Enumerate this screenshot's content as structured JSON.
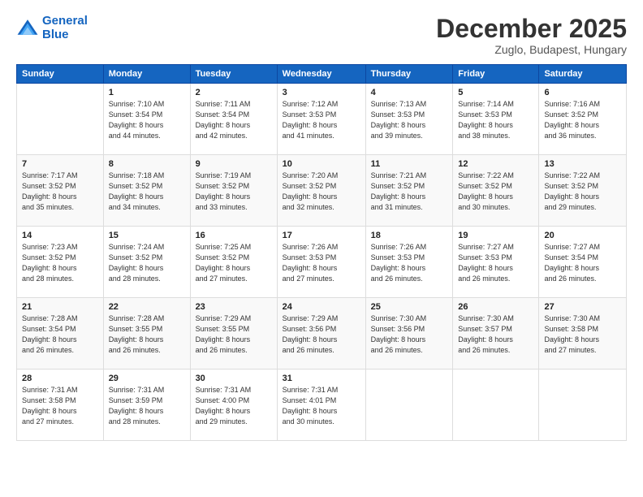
{
  "logo": {
    "line1": "General",
    "line2": "Blue"
  },
  "header": {
    "month": "December 2025",
    "location": "Zuglo, Budapest, Hungary"
  },
  "weekdays": [
    "Sunday",
    "Monday",
    "Tuesday",
    "Wednesday",
    "Thursday",
    "Friday",
    "Saturday"
  ],
  "weeks": [
    [
      {
        "day": "",
        "info": ""
      },
      {
        "day": "1",
        "info": "Sunrise: 7:10 AM\nSunset: 3:54 PM\nDaylight: 8 hours\nand 44 minutes."
      },
      {
        "day": "2",
        "info": "Sunrise: 7:11 AM\nSunset: 3:54 PM\nDaylight: 8 hours\nand 42 minutes."
      },
      {
        "day": "3",
        "info": "Sunrise: 7:12 AM\nSunset: 3:53 PM\nDaylight: 8 hours\nand 41 minutes."
      },
      {
        "day": "4",
        "info": "Sunrise: 7:13 AM\nSunset: 3:53 PM\nDaylight: 8 hours\nand 39 minutes."
      },
      {
        "day": "5",
        "info": "Sunrise: 7:14 AM\nSunset: 3:53 PM\nDaylight: 8 hours\nand 38 minutes."
      },
      {
        "day": "6",
        "info": "Sunrise: 7:16 AM\nSunset: 3:52 PM\nDaylight: 8 hours\nand 36 minutes."
      }
    ],
    [
      {
        "day": "7",
        "info": "Sunrise: 7:17 AM\nSunset: 3:52 PM\nDaylight: 8 hours\nand 35 minutes."
      },
      {
        "day": "8",
        "info": "Sunrise: 7:18 AM\nSunset: 3:52 PM\nDaylight: 8 hours\nand 34 minutes."
      },
      {
        "day": "9",
        "info": "Sunrise: 7:19 AM\nSunset: 3:52 PM\nDaylight: 8 hours\nand 33 minutes."
      },
      {
        "day": "10",
        "info": "Sunrise: 7:20 AM\nSunset: 3:52 PM\nDaylight: 8 hours\nand 32 minutes."
      },
      {
        "day": "11",
        "info": "Sunrise: 7:21 AM\nSunset: 3:52 PM\nDaylight: 8 hours\nand 31 minutes."
      },
      {
        "day": "12",
        "info": "Sunrise: 7:22 AM\nSunset: 3:52 PM\nDaylight: 8 hours\nand 30 minutes."
      },
      {
        "day": "13",
        "info": "Sunrise: 7:22 AM\nSunset: 3:52 PM\nDaylight: 8 hours\nand 29 minutes."
      }
    ],
    [
      {
        "day": "14",
        "info": "Sunrise: 7:23 AM\nSunset: 3:52 PM\nDaylight: 8 hours\nand 28 minutes."
      },
      {
        "day": "15",
        "info": "Sunrise: 7:24 AM\nSunset: 3:52 PM\nDaylight: 8 hours\nand 28 minutes."
      },
      {
        "day": "16",
        "info": "Sunrise: 7:25 AM\nSunset: 3:52 PM\nDaylight: 8 hours\nand 27 minutes."
      },
      {
        "day": "17",
        "info": "Sunrise: 7:26 AM\nSunset: 3:53 PM\nDaylight: 8 hours\nand 27 minutes."
      },
      {
        "day": "18",
        "info": "Sunrise: 7:26 AM\nSunset: 3:53 PM\nDaylight: 8 hours\nand 26 minutes."
      },
      {
        "day": "19",
        "info": "Sunrise: 7:27 AM\nSunset: 3:53 PM\nDaylight: 8 hours\nand 26 minutes."
      },
      {
        "day": "20",
        "info": "Sunrise: 7:27 AM\nSunset: 3:54 PM\nDaylight: 8 hours\nand 26 minutes."
      }
    ],
    [
      {
        "day": "21",
        "info": "Sunrise: 7:28 AM\nSunset: 3:54 PM\nDaylight: 8 hours\nand 26 minutes."
      },
      {
        "day": "22",
        "info": "Sunrise: 7:28 AM\nSunset: 3:55 PM\nDaylight: 8 hours\nand 26 minutes."
      },
      {
        "day": "23",
        "info": "Sunrise: 7:29 AM\nSunset: 3:55 PM\nDaylight: 8 hours\nand 26 minutes."
      },
      {
        "day": "24",
        "info": "Sunrise: 7:29 AM\nSunset: 3:56 PM\nDaylight: 8 hours\nand 26 minutes."
      },
      {
        "day": "25",
        "info": "Sunrise: 7:30 AM\nSunset: 3:56 PM\nDaylight: 8 hours\nand 26 minutes."
      },
      {
        "day": "26",
        "info": "Sunrise: 7:30 AM\nSunset: 3:57 PM\nDaylight: 8 hours\nand 26 minutes."
      },
      {
        "day": "27",
        "info": "Sunrise: 7:30 AM\nSunset: 3:58 PM\nDaylight: 8 hours\nand 27 minutes."
      }
    ],
    [
      {
        "day": "28",
        "info": "Sunrise: 7:31 AM\nSunset: 3:58 PM\nDaylight: 8 hours\nand 27 minutes."
      },
      {
        "day": "29",
        "info": "Sunrise: 7:31 AM\nSunset: 3:59 PM\nDaylight: 8 hours\nand 28 minutes."
      },
      {
        "day": "30",
        "info": "Sunrise: 7:31 AM\nSunset: 4:00 PM\nDaylight: 8 hours\nand 29 minutes."
      },
      {
        "day": "31",
        "info": "Sunrise: 7:31 AM\nSunset: 4:01 PM\nDaylight: 8 hours\nand 30 minutes."
      },
      {
        "day": "",
        "info": ""
      },
      {
        "day": "",
        "info": ""
      },
      {
        "day": "",
        "info": ""
      }
    ]
  ]
}
